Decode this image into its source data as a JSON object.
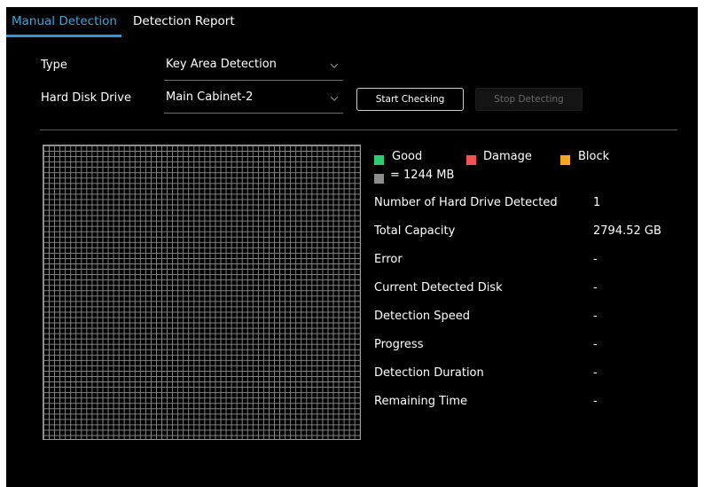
{
  "tabs": [
    {
      "label": "Manual Detection",
      "active": true
    },
    {
      "label": "Detection Report",
      "active": false
    }
  ],
  "form": {
    "type_label": "Type",
    "type_value": "Key Area Detection",
    "hdd_label": "Hard Disk Drive",
    "hdd_value": "Main Cabinet-2",
    "start_button": "Start Checking",
    "stop_button": "Stop Detecting"
  },
  "legend": {
    "good": "Good",
    "damage": "Damage",
    "block": "Block",
    "unit": "= 1244 MB"
  },
  "colors": {
    "accent": "#2f97d6",
    "good": "#2ecc71",
    "damage": "#f25252",
    "block": "#f5a623",
    "unit": "#8c8c8c"
  },
  "info": [
    {
      "label": "Number of Hard Drive Detected",
      "value": "1"
    },
    {
      "label": "Total Capacity",
      "value": "2794.52 GB"
    },
    {
      "label": "Error",
      "value": "-"
    },
    {
      "label": "Current Detected Disk",
      "value": "-"
    },
    {
      "label": "Detection Speed",
      "value": "-"
    },
    {
      "label": "Progress",
      "value": "-"
    },
    {
      "label": "Detection Duration",
      "value": "-"
    },
    {
      "label": "Remaining Time",
      "value": "-"
    }
  ]
}
